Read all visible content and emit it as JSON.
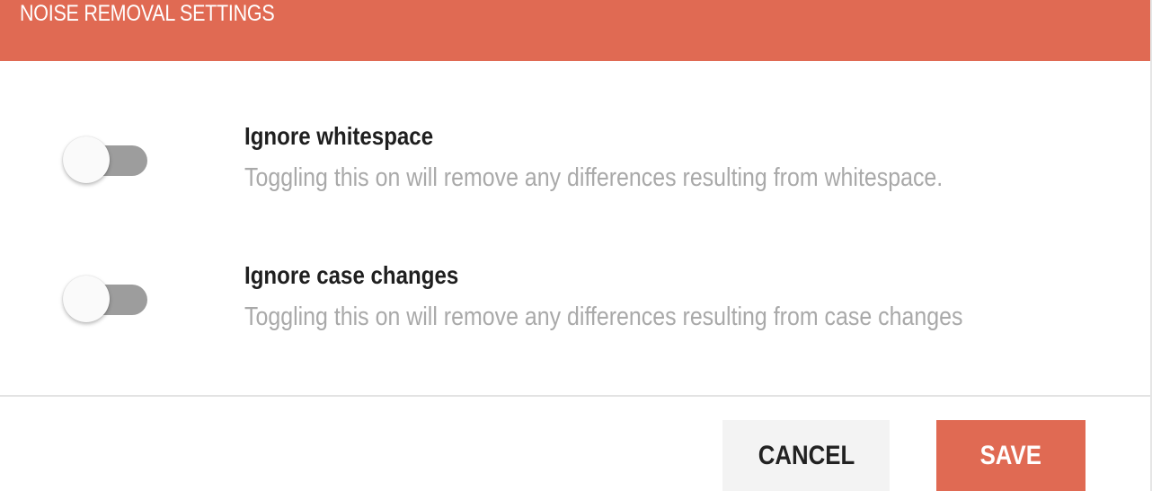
{
  "dialog": {
    "title": "NOISE REMOVAL SETTINGS"
  },
  "settings": [
    {
      "title": "Ignore whitespace",
      "description": "Toggling this on will remove any differences resulting from whitespace.",
      "enabled": false
    },
    {
      "title": "Ignore case changes",
      "description": "Toggling this on will remove any differences resulting from case changes",
      "enabled": false
    }
  ],
  "actions": {
    "cancel_label": "CANCEL",
    "save_label": "SAVE"
  },
  "colors": {
    "accent": "#e06a53",
    "toggle_track_off": "#9d9d9d",
    "muted_text": "#a9a9a9"
  },
  "icons": {
    "toggle": "toggle-switch-off"
  }
}
